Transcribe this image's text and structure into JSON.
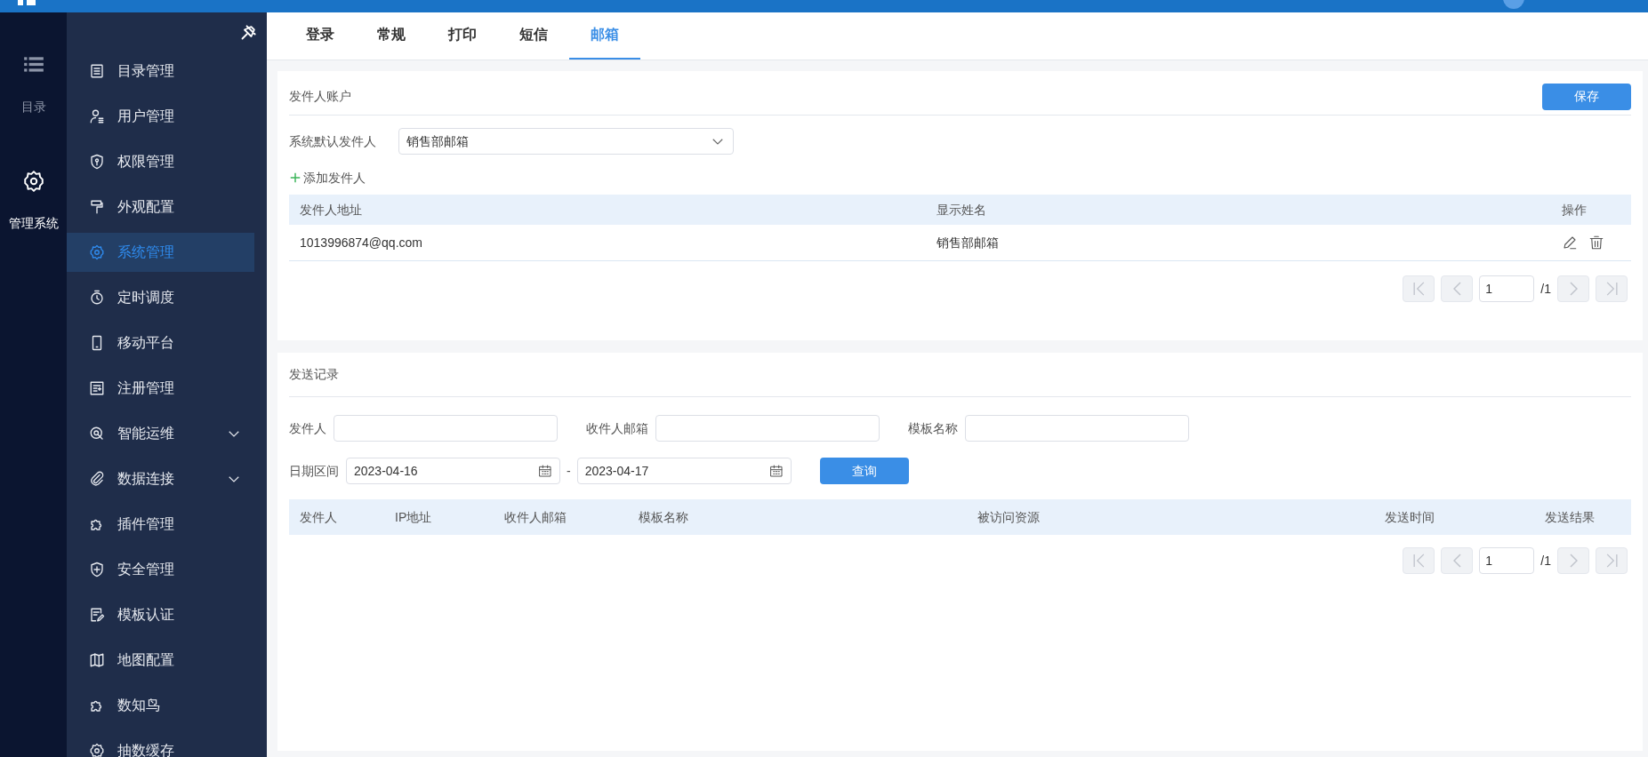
{
  "rail": [
    {
      "label": "目录",
      "selected": false
    },
    {
      "label": "管理系统",
      "selected": true
    }
  ],
  "sidebar": {
    "items": [
      {
        "label": "目录管理",
        "selected": false
      },
      {
        "label": "用户管理",
        "selected": false
      },
      {
        "label": "权限管理",
        "selected": false
      },
      {
        "label": "外观配置",
        "selected": false
      },
      {
        "label": "系统管理",
        "selected": true
      },
      {
        "label": "定时调度",
        "selected": false
      },
      {
        "label": "移动平台",
        "selected": false
      },
      {
        "label": "注册管理",
        "selected": false
      },
      {
        "label": "智能运维",
        "selected": false,
        "expanded": false
      },
      {
        "label": "数据连接",
        "selected": false,
        "expanded": false
      },
      {
        "label": "插件管理",
        "selected": false
      },
      {
        "label": "安全管理",
        "selected": false
      },
      {
        "label": "模板认证",
        "selected": false
      },
      {
        "label": "地图配置",
        "selected": false
      },
      {
        "label": "数知鸟",
        "selected": false
      },
      {
        "label": "抽数缓存",
        "selected": false
      }
    ]
  },
  "tabs": [
    {
      "label": "登录",
      "selected": false
    },
    {
      "label": "常规",
      "selected": false
    },
    {
      "label": "打印",
      "selected": false
    },
    {
      "label": "短信",
      "selected": false
    },
    {
      "label": "邮箱",
      "selected": true
    }
  ],
  "sender_panel": {
    "title": "发件人账户",
    "save_button": "保存",
    "default_sender": {
      "label": "系统默认发件人",
      "value": "销售部邮箱"
    },
    "add_button": "添加发件人",
    "table": {
      "columns": [
        "发件人地址",
        "显示姓名",
        "操作"
      ],
      "rows": [
        {
          "address": "1013996874@qq.com",
          "name": "销售部邮箱"
        }
      ]
    },
    "pagination": {
      "page": "1",
      "total": "/1"
    }
  },
  "log_panel": {
    "title": "发送记录",
    "filters": [
      {
        "label": "发件人"
      },
      {
        "label": "收件人邮箱"
      },
      {
        "label": "模板名称"
      }
    ],
    "date_range": {
      "label": "日期区间",
      "start": "2023-04-16",
      "separator": "-",
      "end": "2023-04-17"
    },
    "query_button": "查询",
    "table": {
      "columns": [
        "发件人",
        "IP地址",
        "收件人邮箱",
        "模板名称",
        "被访问资源",
        "发送时间",
        "发送结果"
      ]
    },
    "pagination": {
      "page": "1",
      "total": "/1"
    }
  }
}
